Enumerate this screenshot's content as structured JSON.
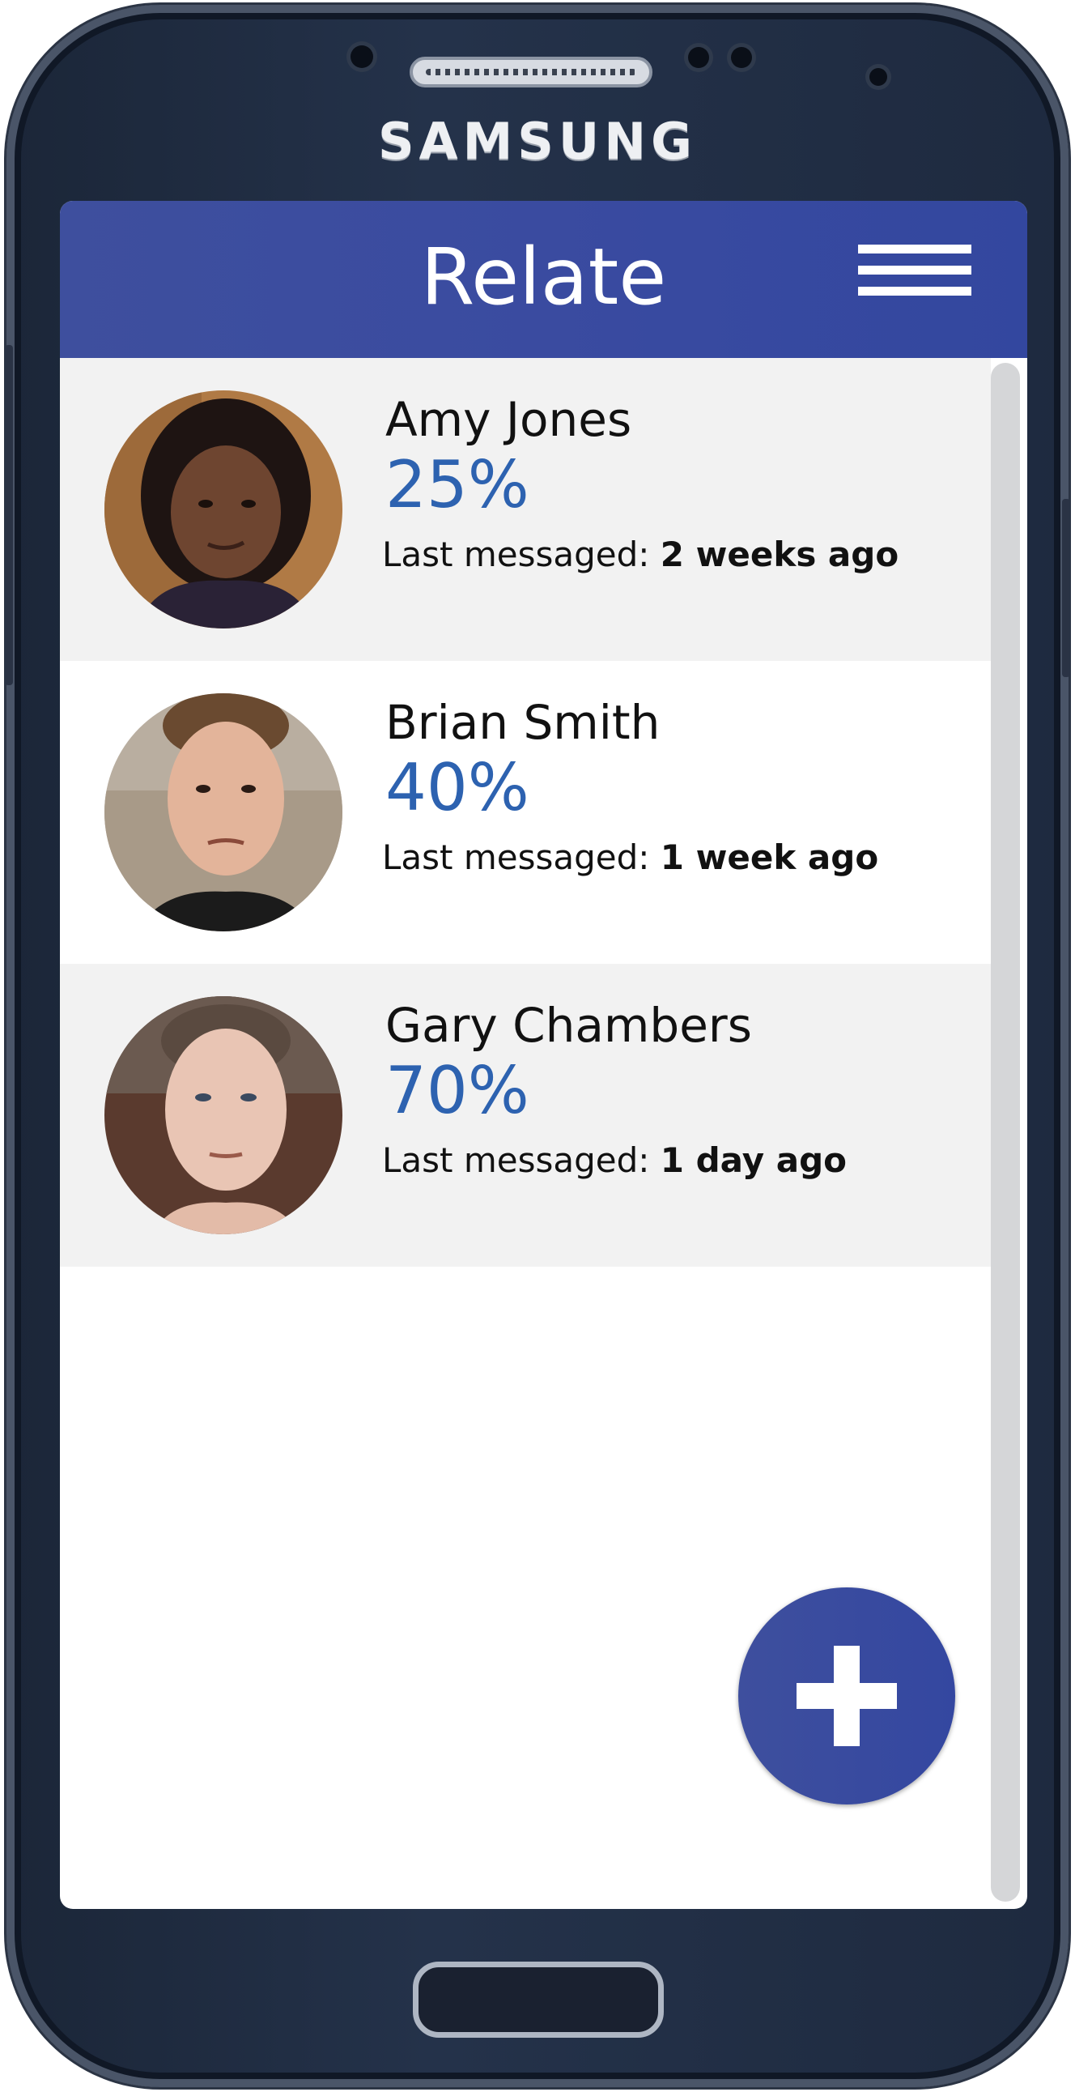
{
  "device": {
    "brand": "SAMSUNG"
  },
  "app": {
    "title": "Relate",
    "accent_color": "#3a4ba0",
    "percent_color": "#2d62b0"
  },
  "header": {
    "menu_icon": "hamburger-menu-icon"
  },
  "contacts": [
    {
      "name": "Amy Jones",
      "percent": "25%",
      "last_label": "Last messaged: ",
      "last_value": "2 weeks ago"
    },
    {
      "name": "Brian Smith",
      "percent": "40%",
      "last_label": "Last messaged: ",
      "last_value": "1 week ago"
    },
    {
      "name": "Gary Chambers",
      "percent": "70%",
      "last_label": "Last messaged: ",
      "last_value": "1 day ago"
    }
  ],
  "fab": {
    "icon": "plus-icon"
  }
}
